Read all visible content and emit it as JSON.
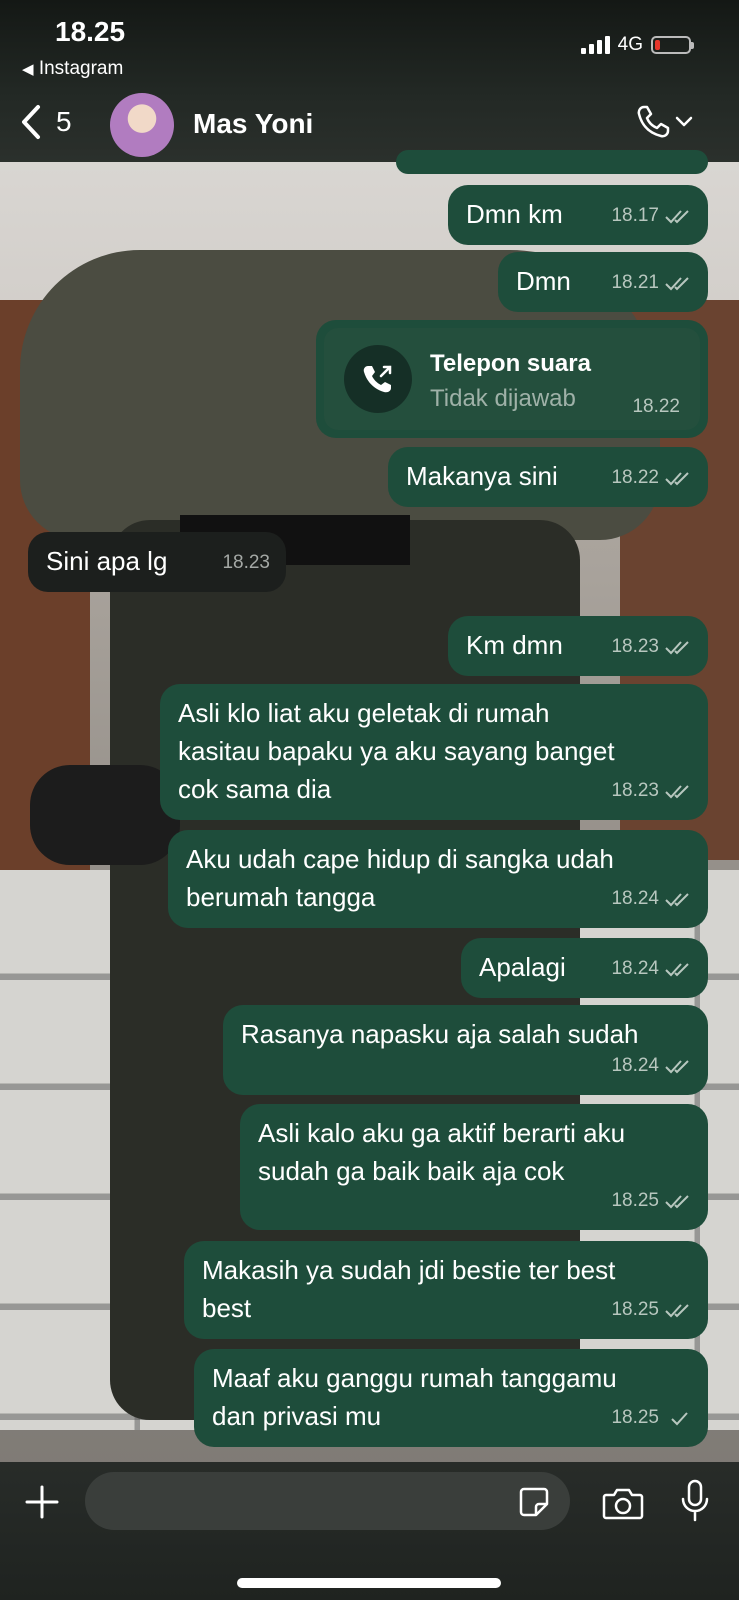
{
  "status": {
    "time": "18.25",
    "back_app": "Instagram",
    "network": "4G"
  },
  "header": {
    "back_count": "5",
    "contact_name": "Mas Yoni"
  },
  "call_log": {
    "title": "Telepon suara",
    "subtitle": "Tidak dijawab",
    "time": "18.22"
  },
  "messages": [
    {
      "text": "Dmn km",
      "time": "18.17",
      "status": "read"
    },
    {
      "text": "Dmn",
      "time": "18.21",
      "status": "read"
    },
    {
      "text": "Makanya sini",
      "time": "18.22",
      "status": "read"
    },
    {
      "text": "Sini apa lg",
      "time": "18.23",
      "status": ""
    },
    {
      "text": "Km dmn",
      "time": "18.23",
      "status": "read"
    },
    {
      "text": "Asli klo liat aku geletak di rumah\nkasitau bapaku ya aku sayang banget\ncok sama dia",
      "time": "18.23",
      "status": "read"
    },
    {
      "text": "Aku udah cape hidup di sangka udah\nberumah tangga",
      "time": "18.24",
      "status": "read"
    },
    {
      "text": "Apalagi",
      "time": "18.24",
      "status": "read"
    },
    {
      "text": "Rasanya napasku aja salah sudah",
      "time": "18.24",
      "status": "read"
    },
    {
      "text": "Asli kalo aku ga aktif berarti aku\nsudah ga baik baik aja cok",
      "time": "18.25",
      "status": "read"
    },
    {
      "text": "Makasih ya sudah jdi bestie ter best\nbest",
      "time": "18.25",
      "status": "read"
    },
    {
      "text": "Maaf aku ganggu rumah tanggamu\ndan privasi mu",
      "time": "18.25",
      "status": "sent"
    }
  ],
  "colors": {
    "outgoing_bubble": "#1e4d3b",
    "incoming_bubble": "#1c1f1d",
    "battery_low": "#e5352b"
  },
  "icons": [
    "back-chevron-icon",
    "phone-icon",
    "chevron-down-icon",
    "missed-call-icon",
    "plus-icon",
    "sticker-icon",
    "camera-icon",
    "microphone-icon",
    "read-ticks-icon",
    "sent-tick-icon"
  ]
}
